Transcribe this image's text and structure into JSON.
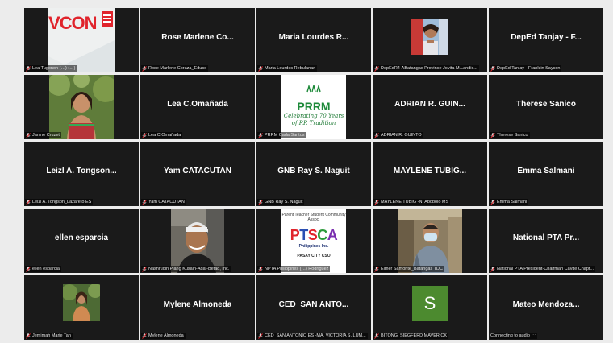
{
  "tiles": [
    {
      "display_name": "",
      "tag": "Lea Tugonon (…) (…)",
      "video": "vcon"
    },
    {
      "display_name": "Rose Marlene Co...",
      "tag": "Rose Marlene Coraza_Educo"
    },
    {
      "display_name": "Maria Lourdes R...",
      "tag": "Maria Lourdes Rebulanan"
    },
    {
      "display_name": "",
      "tag": "DepEdR4-ABatangas Province Jovita M.Landic...",
      "video": "woman-outdoor"
    },
    {
      "display_name": "DepEd Tanjay - F...",
      "tag": "DepEd Tanjay - Franklin Saycon"
    },
    {
      "display_name": "",
      "tag": "Janine Cruzet",
      "video": "janine"
    },
    {
      "display_name": "Lea C.Omañada",
      "tag": "Lea C.Omañada"
    },
    {
      "display_name": "",
      "tag": "PRRM Carla Santos",
      "video": "prrm"
    },
    {
      "display_name": "ADRIAN R. GUIN...",
      "tag": "ADRIAN R. GUINTO"
    },
    {
      "display_name": "Therese Sanico",
      "tag": "Therese Sanico"
    },
    {
      "display_name": "Leizl A. Tongson...",
      "tag": "Leizl A. Tongson_Lazareto ES"
    },
    {
      "display_name": "Yam CATACUTAN",
      "tag": "Yam CATACUTAN"
    },
    {
      "display_name": "GNB Ray S. Naguit",
      "tag": "GNB Ray S. Naguit"
    },
    {
      "display_name": "MAYLENE  TUBIG...",
      "tag": "MAYLENE TUBIG -N. Abobolo MS"
    },
    {
      "display_name": "Emma Salmani",
      "tag": "Emma Salmani"
    },
    {
      "display_name": "ellen esparcia",
      "tag": "ellen esparcia"
    },
    {
      "display_name": "",
      "tag": "Nashrudin Piang Kusain-Adat-Betad, Inc.",
      "video": "man-cap"
    },
    {
      "display_name": "",
      "tag": "NPTA Philippines (…) Rodriguez",
      "video": "ptsca"
    },
    {
      "display_name": "",
      "tag": "Elmer Samonte_Batangas TDC",
      "video": "man-mask"
    },
    {
      "display_name": "National PTA Pr...",
      "tag": "National PTA President-Chairman Cavite Chapt..."
    },
    {
      "display_name": "",
      "tag": "Jemimah Marie Tan",
      "video": "jemimah"
    },
    {
      "display_name": "Mylene Almoneda",
      "tag": "Mylene Almoneda"
    },
    {
      "display_name": "CED_SAN  ANTO...",
      "tag": "CED_SAN ANTONIO ES -MA. VICTORIA S. LUM..."
    },
    {
      "display_name": "",
      "tag": "BITONG, SIEGFERD MAVERICK",
      "avatar_letter": "S"
    },
    {
      "display_name": "Mateo Mendoza...",
      "tag": "Connecting to audio",
      "connecting": true
    }
  ],
  "vcon": {
    "word": "VCON",
    "badge": "OCT"
  },
  "prrm": {
    "word": "PRRM",
    "line1": "Celebrating 70 Years",
    "line2": "of RR Tradition"
  },
  "ptsca": {
    "org": "Parent Teacher Student Community Assoc.",
    "word": "PTSCA",
    "sub": "Philippines Inc.",
    "city": "PASAY CITY CSO"
  },
  "colors": {
    "tile_bg": "#1a1a1a",
    "muted_red": "#e0242c",
    "avatar_green": "#4c8a2f"
  }
}
